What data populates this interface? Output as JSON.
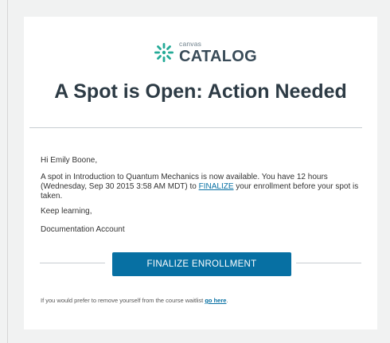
{
  "brand": {
    "logo_small": "canvas",
    "logo_big": "CATALOG",
    "logo_color": "#24aa97"
  },
  "headline": {
    "plain": "A Spot is Open: ",
    "bold": "Action Needed"
  },
  "email": {
    "greeting": "Hi Emily Boone,",
    "para_before_link": "A spot in Introduction to Quantum Mechanics is now available. You have 12 hours (Wednesday, Sep 30 2015 3:58 AM MDT) to ",
    "para_link": "FINALIZE",
    "para_after_link": " your enrollment before your spot is taken.",
    "closing": "Keep learning,",
    "signature": "Documentation Account"
  },
  "cta": {
    "label": "FINALIZE ENROLLMENT",
    "color": "#0770a3"
  },
  "footer": {
    "text": "If you would prefer to remove yourself from the course waitlist ",
    "link": "go here",
    "end": "."
  }
}
